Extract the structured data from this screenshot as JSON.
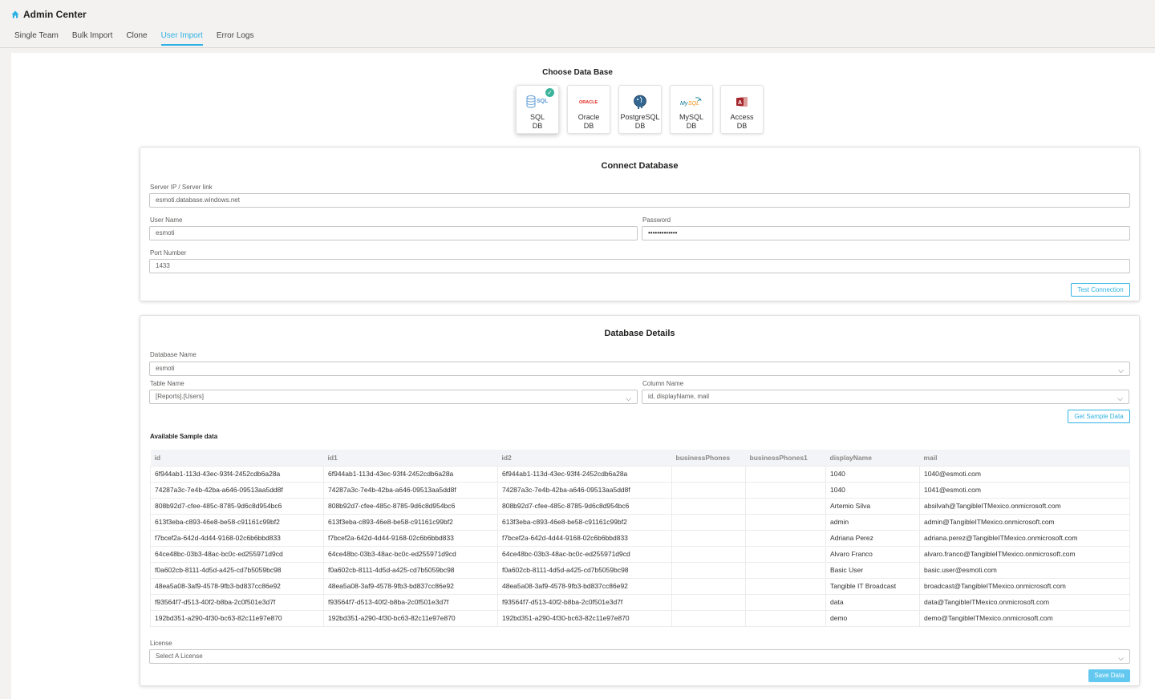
{
  "app": {
    "title": "Admin Center",
    "icon": "home-icon"
  },
  "tabs": [
    {
      "label": "Single Team",
      "active": false
    },
    {
      "label": "Bulk Import",
      "active": false
    },
    {
      "label": "Clone",
      "active": false
    },
    {
      "label": "User Import",
      "active": true
    },
    {
      "label": "Error Logs",
      "active": false
    }
  ],
  "choose_db": {
    "title": "Choose Data Base",
    "options": [
      {
        "line1": "SQL",
        "line2": "DB",
        "icon": "sql-db-icon",
        "selected": true
      },
      {
        "line1": "Oracle",
        "line2": "DB",
        "icon": "oracle-logo-icon",
        "selected": false
      },
      {
        "line1": "PostgreSQL",
        "line2": "DB",
        "icon": "postgresql-elephant-icon",
        "selected": false
      },
      {
        "line1": "MySQL",
        "line2": "DB",
        "icon": "mysql-dolphin-icon",
        "selected": false
      },
      {
        "line1": "Access",
        "line2": "DB",
        "icon": "access-logo-icon",
        "selected": false
      }
    ]
  },
  "connect": {
    "title": "Connect Database",
    "server_label": "Server IP / Server link",
    "server_value": "esmoti.database.windows.net",
    "username_label": "User Name",
    "username_value": "esmoti",
    "password_label": "Password",
    "password_value": "•••••••••••••",
    "port_label": "Port Number",
    "port_value": "1433",
    "test_button": "Test Connection"
  },
  "details": {
    "title": "Database Details",
    "dbname_label": "Database Name",
    "dbname_value": "esmoti",
    "table_label": "Table Name",
    "table_value": "[Reports].[Users]",
    "column_label": "Column Name",
    "column_value": "id, displayName, mail",
    "sample_button": "Get Sample Data",
    "sample_title": "Available Sample data",
    "license_label": "License",
    "license_placeholder": "Select A License",
    "save_button": "Save Data"
  },
  "table": {
    "headers": [
      "id",
      "id1",
      "id2",
      "businessPhones",
      "businessPhones1",
      "displayName",
      "mail"
    ],
    "rows": [
      [
        "6f944ab1-113d-43ec-93f4-2452cdb6a28a",
        "6f944ab1-113d-43ec-93f4-2452cdb6a28a",
        "6f944ab1-113d-43ec-93f4-2452cdb6a28a",
        "",
        "",
        "1040",
        "1040@esmoti.com"
      ],
      [
        "74287a3c-7e4b-42ba-a646-09513aa5dd8f",
        "74287a3c-7e4b-42ba-a646-09513aa5dd8f",
        "74287a3c-7e4b-42ba-a646-09513aa5dd8f",
        "",
        "",
        "1040",
        "1041@esmoti.com"
      ],
      [
        "808b92d7-cfee-485c-8785-9d6c8d954bc6",
        "808b92d7-cfee-485c-8785-9d6c8d954bc6",
        "808b92d7-cfee-485c-8785-9d6c8d954bc6",
        "",
        "",
        "Artemio Silva",
        "absilvah@TangibleITMexico.onmicrosoft.com"
      ],
      [
        "613f3eba-c893-46e8-be58-c91161c99bf2",
        "613f3eba-c893-46e8-be58-c91161c99bf2",
        "613f3eba-c893-46e8-be58-c91161c99bf2",
        "",
        "",
        "admin",
        "admin@TangibleITMexico.onmicrosoft.com"
      ],
      [
        "f7bcef2a-642d-4d44-9168-02c6b6bbd833",
        "f7bcef2a-642d-4d44-9168-02c6b6bbd833",
        "f7bcef2a-642d-4d44-9168-02c6b6bbd833",
        "",
        "",
        "Adriana Perez",
        "adriana.perez@TangibleITMexico.onmicrosoft.com"
      ],
      [
        "64ce48bc-03b3-48ac-bc0c-ed255971d9cd",
        "64ce48bc-03b3-48ac-bc0c-ed255971d9cd",
        "64ce48bc-03b3-48ac-bc0c-ed255971d9cd",
        "",
        "",
        "Alvaro Franco",
        "alvaro.franco@TangibleITMexico.onmicrosoft.com"
      ],
      [
        "f0a602cb-8111-4d5d-a425-cd7b5059bc98",
        "f0a602cb-8111-4d5d-a425-cd7b5059bc98",
        "f0a602cb-8111-4d5d-a425-cd7b5059bc98",
        "",
        "",
        "Basic User",
        "basic.user@esmoti.com"
      ],
      [
        "48ea5a08-3af9-4578-9fb3-bd837cc86e92",
        "48ea5a08-3af9-4578-9fb3-bd837cc86e92",
        "48ea5a08-3af9-4578-9fb3-bd837cc86e92",
        "",
        "",
        "Tangible IT Broadcast",
        "broadcast@TangibleITMexico.onmicrosoft.com"
      ],
      [
        "f93564f7-d513-40f2-b8ba-2c0f501e3d7f",
        "f93564f7-d513-40f2-b8ba-2c0f501e3d7f",
        "f93564f7-d513-40f2-b8ba-2c0f501e3d7f",
        "",
        "",
        "data",
        "data@TangibleITMexico.onmicrosoft.com"
      ],
      [
        "192bd351-a290-4f30-bc63-82c11e97e870",
        "192bd351-a290-4f30-bc63-82c11e97e870",
        "192bd351-a290-4f30-bc63-82c11e97e870",
        "",
        "",
        "demo",
        "demo@TangibleITMexico.onmicrosoft.com"
      ]
    ]
  },
  "colors": {
    "accent": "#2fb2e3",
    "check": "#3bb39b",
    "save_button": "#63c8ef"
  }
}
